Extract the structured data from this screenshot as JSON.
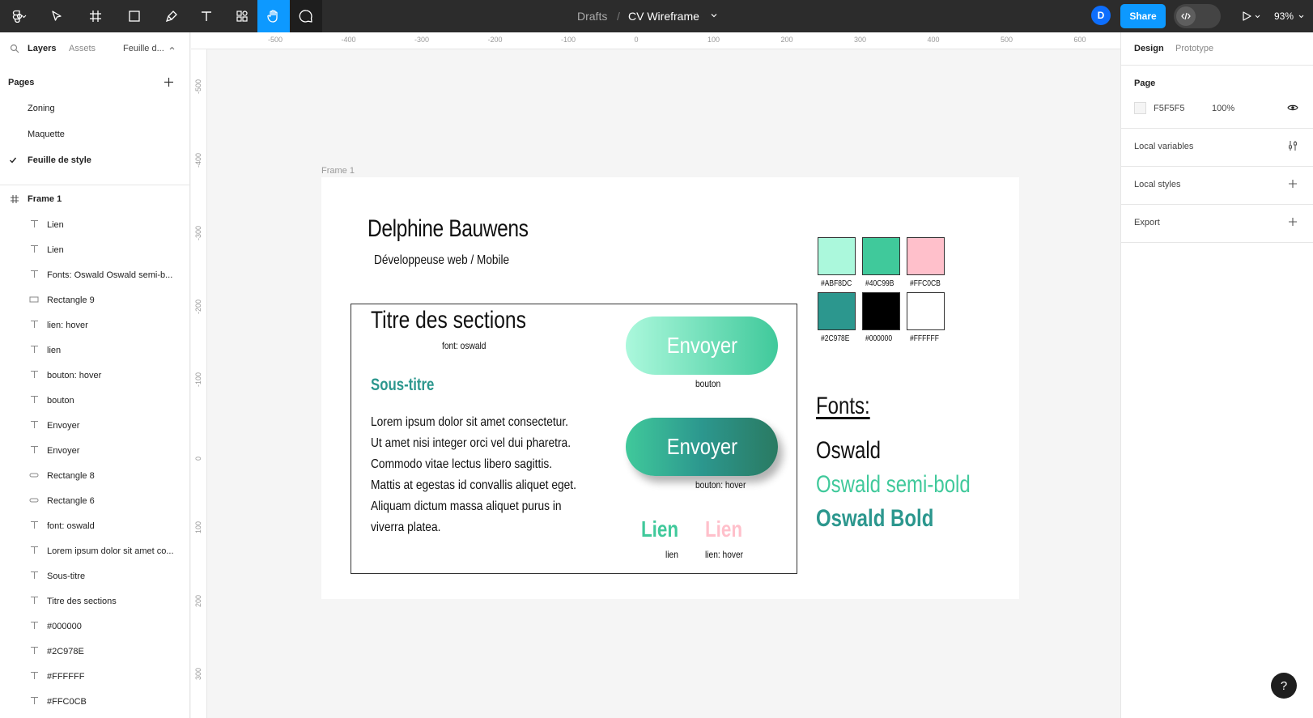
{
  "topbar": {
    "breadcrumb_root": "Drafts",
    "breadcrumb_sep": "/",
    "file_name": "CV Wireframe",
    "avatar_initial": "D",
    "share_label": "Share",
    "zoom": "93%"
  },
  "left_panel": {
    "tabs": {
      "layers": "Layers",
      "assets": "Assets",
      "page_selector": "Feuille d..."
    },
    "pages_heading": "Pages",
    "pages": [
      {
        "label": "Zoning",
        "active": false
      },
      {
        "label": "Maquette",
        "active": false
      },
      {
        "label": "Feuille de style",
        "active": true
      }
    ],
    "frame_layer": "Frame 1",
    "layers": [
      {
        "label": "Lien",
        "icon": "text-icon"
      },
      {
        "label": "Lien",
        "icon": "text-icon"
      },
      {
        "label": "Fonts: Oswald Oswald semi-b...",
        "icon": "text-icon"
      },
      {
        "label": "Rectangle 9",
        "icon": "rectangle-icon"
      },
      {
        "label": "lien: hover",
        "icon": "text-icon"
      },
      {
        "label": "lien",
        "icon": "text-icon"
      },
      {
        "label": "bouton: hover",
        "icon": "text-icon"
      },
      {
        "label": "bouton",
        "icon": "text-icon"
      },
      {
        "label": "Envoyer",
        "icon": "text-icon"
      },
      {
        "label": "Envoyer",
        "icon": "text-icon"
      },
      {
        "label": "Rectangle 8",
        "icon": "rounded-rectangle-icon"
      },
      {
        "label": "Rectangle 6",
        "icon": "rounded-rectangle-icon"
      },
      {
        "label": "font: oswald",
        "icon": "text-icon"
      },
      {
        "label": "Lorem ipsum dolor sit amet co...",
        "icon": "text-icon"
      },
      {
        "label": "Sous-titre",
        "icon": "text-icon"
      },
      {
        "label": "Titre des sections",
        "icon": "text-icon"
      },
      {
        "label": "#000000",
        "icon": "text-icon"
      },
      {
        "label": "#2C978E",
        "icon": "text-icon"
      },
      {
        "label": "#FFFFFF",
        "icon": "text-icon"
      },
      {
        "label": "#FFC0CB",
        "icon": "text-icon"
      }
    ]
  },
  "rulers": {
    "top": [
      "-500",
      "-400",
      "-300",
      "-200",
      "-100",
      "0",
      "100",
      "200",
      "300",
      "400",
      "500",
      "600"
    ],
    "left": [
      "-500",
      "-400",
      "-300",
      "-200",
      "-100",
      "0",
      "100",
      "200",
      "300"
    ]
  },
  "canvas": {
    "frame_label": "Frame 1",
    "name": "Delphine Bauwens",
    "role": "Développeuse web / Mobile",
    "section_title": "Titre des sections",
    "section_font": "font: oswald",
    "subtitle": "Sous-titre",
    "lorem_lines": [
      "Lorem ipsum dolor sit amet consectetur.",
      "Ut amet nisi integer orci vel dui pharetra.",
      "Commodo vitae lectus libero sagittis.",
      "Mattis at egestas id convallis aliquet eget.",
      "Aliquam dictum massa aliquet purus in",
      "viverra platea."
    ],
    "button_label": "Envoyer",
    "button_caption": "bouton",
    "button_hover_label": "Envoyer",
    "button_hover_caption": "bouton: hover",
    "link_label": "Lien",
    "link_caption": "lien",
    "link_hover_label": "Lien",
    "link_hover_caption": "lien: hover",
    "swatches": [
      {
        "hex": "#ABF8DC",
        "color": "#abf8dc"
      },
      {
        "hex": "#40C99B",
        "color": "#40c99b"
      },
      {
        "hex": "#FFC0CB",
        "color": "#ffc0cb"
      },
      {
        "hex": "#2C978E",
        "color": "#2c978e"
      },
      {
        "hex": "#000000",
        "color": "#000000"
      },
      {
        "hex": "#FFFFFF",
        "color": "#ffffff"
      }
    ],
    "fonts_title": "Fonts:",
    "font_regular": "Oswald",
    "font_semibold": "Oswald semi-bold",
    "font_bold": "Oswald Bold"
  },
  "right_panel": {
    "tabs": {
      "design": "Design",
      "prototype": "Prototype"
    },
    "page_heading": "Page",
    "page_color": "F5F5F5",
    "page_opacity": "100%",
    "local_variables": "Local variables",
    "local_styles": "Local styles",
    "export": "Export"
  },
  "help_label": "?"
}
